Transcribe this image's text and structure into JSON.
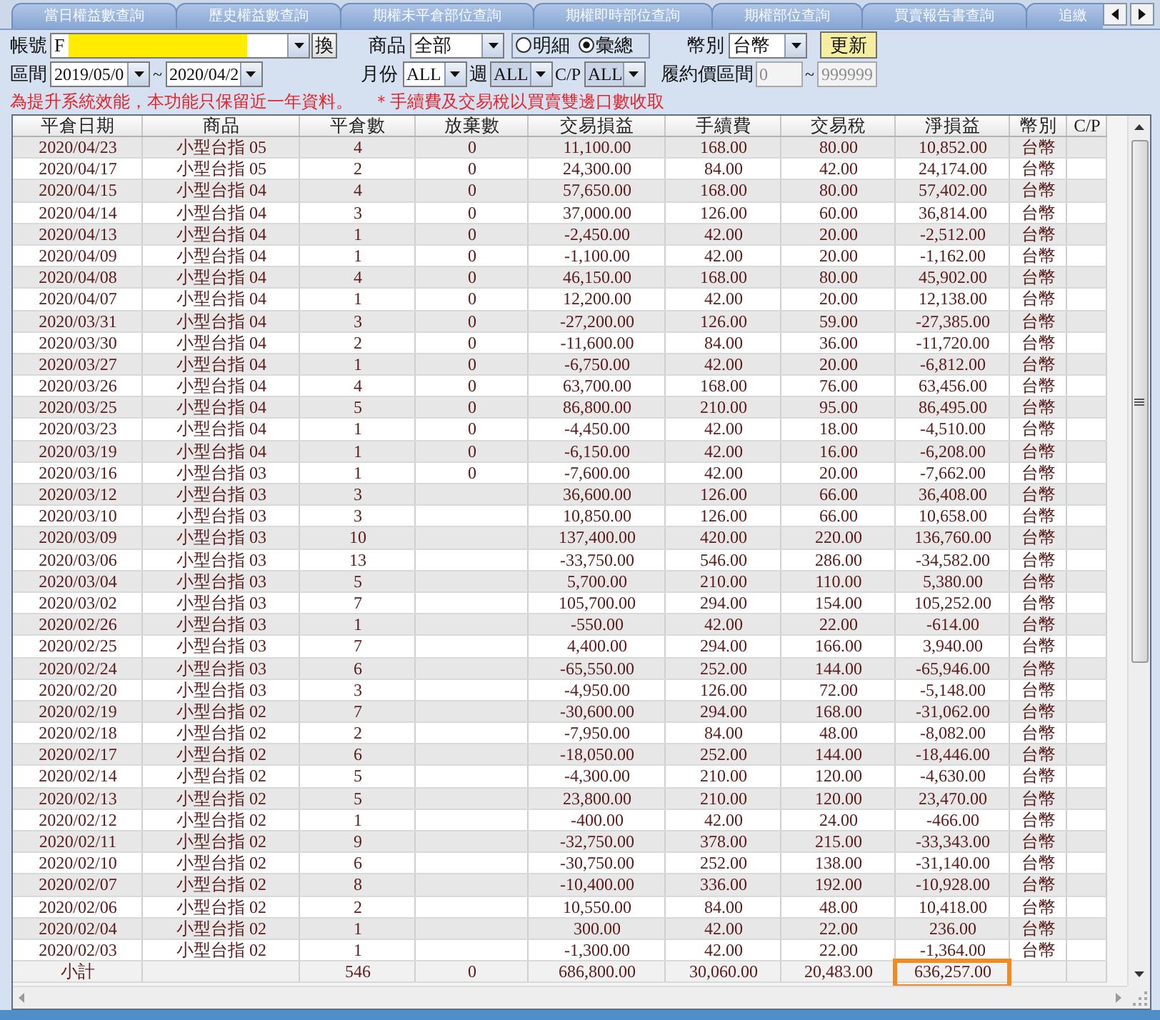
{
  "tabs": [
    {
      "label": "當日權益數查詢",
      "selected": false
    },
    {
      "label": "歷史權益數查詢",
      "selected": false
    },
    {
      "label": "期權未平倉部位查詢",
      "selected": false
    },
    {
      "label": "期權即時部位查詢",
      "selected": false
    },
    {
      "label": "期權部位查詢",
      "selected": false
    },
    {
      "label": "買賣報告書查詢",
      "selected": false
    },
    {
      "label": "追繳",
      "selected": false
    }
  ],
  "form": {
    "account": {
      "label": "帳號",
      "value": "F",
      "redacted": true
    },
    "swap_button": "換",
    "product": {
      "label": "商品",
      "value": "全部"
    },
    "view_mode": [
      {
        "label": "明細",
        "selected": false
      },
      {
        "label": "彙總",
        "selected": true
      }
    ],
    "currency": {
      "label": "幣別",
      "value": "台幣"
    },
    "refresh_button": "更新",
    "period": {
      "label": "區間",
      "from": "2019/05/0",
      "separator": "~",
      "to": "2020/04/2"
    },
    "month": {
      "label": "月份",
      "value": "ALL",
      "disabled": false
    },
    "week": {
      "label": "週",
      "value": "ALL",
      "disabled": true
    },
    "cp": {
      "label": "C/P",
      "value": "ALL",
      "disabled": true
    },
    "strike_range": {
      "label": "履約價區間",
      "from": "0",
      "separator": "~",
      "to": "999999",
      "disabled": true
    }
  },
  "notices": [
    "為提升系統效能，本功能只保留近一年資料。",
    "＊手續費及交易稅以買賣雙邊口數收取"
  ],
  "table": {
    "columns": [
      "平倉日期",
      "商品",
      "平倉數",
      "放棄數",
      "交易損益",
      "手續費",
      "交易稅",
      "淨損益",
      "幣別",
      "C/P"
    ],
    "rows": [
      {
        "date": "2020/04/23",
        "product": "小型台指 05",
        "closed_qty": "4",
        "abandoned_qty": "0",
        "trade_pnl": "11,100.00",
        "fee": "168.00",
        "tax": "80.00",
        "net_pnl": "10,852.00",
        "currency": "台幣"
      },
      {
        "date": "2020/04/17",
        "product": "小型台指 05",
        "closed_qty": "2",
        "abandoned_qty": "0",
        "trade_pnl": "24,300.00",
        "fee": "84.00",
        "tax": "42.00",
        "net_pnl": "24,174.00",
        "currency": "台幣"
      },
      {
        "date": "2020/04/15",
        "product": "小型台指 04",
        "closed_qty": "4",
        "abandoned_qty": "0",
        "trade_pnl": "57,650.00",
        "fee": "168.00",
        "tax": "80.00",
        "net_pnl": "57,402.00",
        "currency": "台幣"
      },
      {
        "date": "2020/04/14",
        "product": "小型台指 04",
        "closed_qty": "3",
        "abandoned_qty": "0",
        "trade_pnl": "37,000.00",
        "fee": "126.00",
        "tax": "60.00",
        "net_pnl": "36,814.00",
        "currency": "台幣"
      },
      {
        "date": "2020/04/13",
        "product": "小型台指 04",
        "closed_qty": "1",
        "abandoned_qty": "0",
        "trade_pnl": "-2,450.00",
        "fee": "42.00",
        "tax": "20.00",
        "net_pnl": "-2,512.00",
        "currency": "台幣"
      },
      {
        "date": "2020/04/09",
        "product": "小型台指 04",
        "closed_qty": "1",
        "abandoned_qty": "0",
        "trade_pnl": "-1,100.00",
        "fee": "42.00",
        "tax": "20.00",
        "net_pnl": "-1,162.00",
        "currency": "台幣"
      },
      {
        "date": "2020/04/08",
        "product": "小型台指 04",
        "closed_qty": "4",
        "abandoned_qty": "0",
        "trade_pnl": "46,150.00",
        "fee": "168.00",
        "tax": "80.00",
        "net_pnl": "45,902.00",
        "currency": "台幣"
      },
      {
        "date": "2020/04/07",
        "product": "小型台指 04",
        "closed_qty": "1",
        "abandoned_qty": "0",
        "trade_pnl": "12,200.00",
        "fee": "42.00",
        "tax": "20.00",
        "net_pnl": "12,138.00",
        "currency": "台幣"
      },
      {
        "date": "2020/03/31",
        "product": "小型台指 04",
        "closed_qty": "3",
        "abandoned_qty": "0",
        "trade_pnl": "-27,200.00",
        "fee": "126.00",
        "tax": "59.00",
        "net_pnl": "-27,385.00",
        "currency": "台幣"
      },
      {
        "date": "2020/03/30",
        "product": "小型台指 04",
        "closed_qty": "2",
        "abandoned_qty": "0",
        "trade_pnl": "-11,600.00",
        "fee": "84.00",
        "tax": "36.00",
        "net_pnl": "-11,720.00",
        "currency": "台幣"
      },
      {
        "date": "2020/03/27",
        "product": "小型台指 04",
        "closed_qty": "1",
        "abandoned_qty": "0",
        "trade_pnl": "-6,750.00",
        "fee": "42.00",
        "tax": "20.00",
        "net_pnl": "-6,812.00",
        "currency": "台幣"
      },
      {
        "date": "2020/03/26",
        "product": "小型台指 04",
        "closed_qty": "4",
        "abandoned_qty": "0",
        "trade_pnl": "63,700.00",
        "fee": "168.00",
        "tax": "76.00",
        "net_pnl": "63,456.00",
        "currency": "台幣"
      },
      {
        "date": "2020/03/25",
        "product": "小型台指 04",
        "closed_qty": "5",
        "abandoned_qty": "0",
        "trade_pnl": "86,800.00",
        "fee": "210.00",
        "tax": "95.00",
        "net_pnl": "86,495.00",
        "currency": "台幣"
      },
      {
        "date": "2020/03/23",
        "product": "小型台指 04",
        "closed_qty": "1",
        "abandoned_qty": "0",
        "trade_pnl": "-4,450.00",
        "fee": "42.00",
        "tax": "18.00",
        "net_pnl": "-4,510.00",
        "currency": "台幣"
      },
      {
        "date": "2020/03/19",
        "product": "小型台指 04",
        "closed_qty": "1",
        "abandoned_qty": "0",
        "trade_pnl": "-6,150.00",
        "fee": "42.00",
        "tax": "16.00",
        "net_pnl": "-6,208.00",
        "currency": "台幣"
      },
      {
        "date": "2020/03/16",
        "product": "小型台指 03",
        "closed_qty": "1",
        "abandoned_qty": "0",
        "trade_pnl": "-7,600.00",
        "fee": "42.00",
        "tax": "20.00",
        "net_pnl": "-7,662.00",
        "currency": "台幣"
      },
      {
        "date": "2020/03/12",
        "product": "小型台指 03",
        "closed_qty": "3",
        "trade_pnl": "36,600.00",
        "fee": "126.00",
        "tax": "66.00",
        "net_pnl": "36,408.00",
        "currency": "台幣"
      },
      {
        "date": "2020/03/10",
        "product": "小型台指 03",
        "closed_qty": "3",
        "trade_pnl": "10,850.00",
        "fee": "126.00",
        "tax": "66.00",
        "net_pnl": "10,658.00",
        "currency": "台幣"
      },
      {
        "date": "2020/03/09",
        "product": "小型台指 03",
        "closed_qty": "10",
        "trade_pnl": "137,400.00",
        "fee": "420.00",
        "tax": "220.00",
        "net_pnl": "136,760.00",
        "currency": "台幣"
      },
      {
        "date": "2020/03/06",
        "product": "小型台指 03",
        "closed_qty": "13",
        "trade_pnl": "-33,750.00",
        "fee": "546.00",
        "tax": "286.00",
        "net_pnl": "-34,582.00",
        "currency": "台幣"
      },
      {
        "date": "2020/03/04",
        "product": "小型台指 03",
        "closed_qty": "5",
        "trade_pnl": "5,700.00",
        "fee": "210.00",
        "tax": "110.00",
        "net_pnl": "5,380.00",
        "currency": "台幣"
      },
      {
        "date": "2020/03/02",
        "product": "小型台指 03",
        "closed_qty": "7",
        "trade_pnl": "105,700.00",
        "fee": "294.00",
        "tax": "154.00",
        "net_pnl": "105,252.00",
        "currency": "台幣"
      },
      {
        "date": "2020/02/26",
        "product": "小型台指 03",
        "closed_qty": "1",
        "trade_pnl": "-550.00",
        "fee": "42.00",
        "tax": "22.00",
        "net_pnl": "-614.00",
        "currency": "台幣"
      },
      {
        "date": "2020/02/25",
        "product": "小型台指 03",
        "closed_qty": "7",
        "trade_pnl": "4,400.00",
        "fee": "294.00",
        "tax": "166.00",
        "net_pnl": "3,940.00",
        "currency": "台幣"
      },
      {
        "date": "2020/02/24",
        "product": "小型台指 03",
        "closed_qty": "6",
        "trade_pnl": "-65,550.00",
        "fee": "252.00",
        "tax": "144.00",
        "net_pnl": "-65,946.00",
        "currency": "台幣"
      },
      {
        "date": "2020/02/20",
        "product": "小型台指 03",
        "closed_qty": "3",
        "trade_pnl": "-4,950.00",
        "fee": "126.00",
        "tax": "72.00",
        "net_pnl": "-5,148.00",
        "currency": "台幣"
      },
      {
        "date": "2020/02/19",
        "product": "小型台指 02",
        "closed_qty": "7",
        "trade_pnl": "-30,600.00",
        "fee": "294.00",
        "tax": "168.00",
        "net_pnl": "-31,062.00",
        "currency": "台幣"
      },
      {
        "date": "2020/02/18",
        "product": "小型台指 02",
        "closed_qty": "2",
        "trade_pnl": "-7,950.00",
        "fee": "84.00",
        "tax": "48.00",
        "net_pnl": "-8,082.00",
        "currency": "台幣"
      },
      {
        "date": "2020/02/17",
        "product": "小型台指 02",
        "closed_qty": "6",
        "trade_pnl": "-18,050.00",
        "fee": "252.00",
        "tax": "144.00",
        "net_pnl": "-18,446.00",
        "currency": "台幣"
      },
      {
        "date": "2020/02/14",
        "product": "小型台指 02",
        "closed_qty": "5",
        "trade_pnl": "-4,300.00",
        "fee": "210.00",
        "tax": "120.00",
        "net_pnl": "-4,630.00",
        "currency": "台幣"
      },
      {
        "date": "2020/02/13",
        "product": "小型台指 02",
        "closed_qty": "5",
        "trade_pnl": "23,800.00",
        "fee": "210.00",
        "tax": "120.00",
        "net_pnl": "23,470.00",
        "currency": "台幣"
      },
      {
        "date": "2020/02/12",
        "product": "小型台指 02",
        "closed_qty": "1",
        "trade_pnl": "-400.00",
        "fee": "42.00",
        "tax": "24.00",
        "net_pnl": "-466.00",
        "currency": "台幣"
      },
      {
        "date": "2020/02/11",
        "product": "小型台指 02",
        "closed_qty": "9",
        "trade_pnl": "-32,750.00",
        "fee": "378.00",
        "tax": "215.00",
        "net_pnl": "-33,343.00",
        "currency": "台幣"
      },
      {
        "date": "2020/02/10",
        "product": "小型台指 02",
        "closed_qty": "6",
        "trade_pnl": "-30,750.00",
        "fee": "252.00",
        "tax": "138.00",
        "net_pnl": "-31,140.00",
        "currency": "台幣"
      },
      {
        "date": "2020/02/07",
        "product": "小型台指 02",
        "closed_qty": "8",
        "trade_pnl": "-10,400.00",
        "fee": "336.00",
        "tax": "192.00",
        "net_pnl": "-10,928.00",
        "currency": "台幣"
      },
      {
        "date": "2020/02/06",
        "product": "小型台指 02",
        "closed_qty": "2",
        "trade_pnl": "10,550.00",
        "fee": "84.00",
        "tax": "48.00",
        "net_pnl": "10,418.00",
        "currency": "台幣"
      },
      {
        "date": "2020/02/04",
        "product": "小型台指 02",
        "closed_qty": "1",
        "trade_pnl": "300.00",
        "fee": "42.00",
        "tax": "22.00",
        "net_pnl": "236.00",
        "currency": "台幣"
      },
      {
        "date": "2020/02/03",
        "product": "小型台指 02",
        "closed_qty": "1",
        "trade_pnl": "-1,300.00",
        "fee": "42.00",
        "tax": "22.00",
        "net_pnl": "-1,364.00",
        "currency": "台幣"
      }
    ],
    "subtotal": {
      "label": "小計",
      "closed_qty": "546",
      "abandoned_qty": "0",
      "trade_pnl": "686,800.00",
      "fee": "30,060.00",
      "tax": "20,483.00",
      "net_pnl": "636,257.00",
      "net_pnl_highlighted": true
    }
  }
}
